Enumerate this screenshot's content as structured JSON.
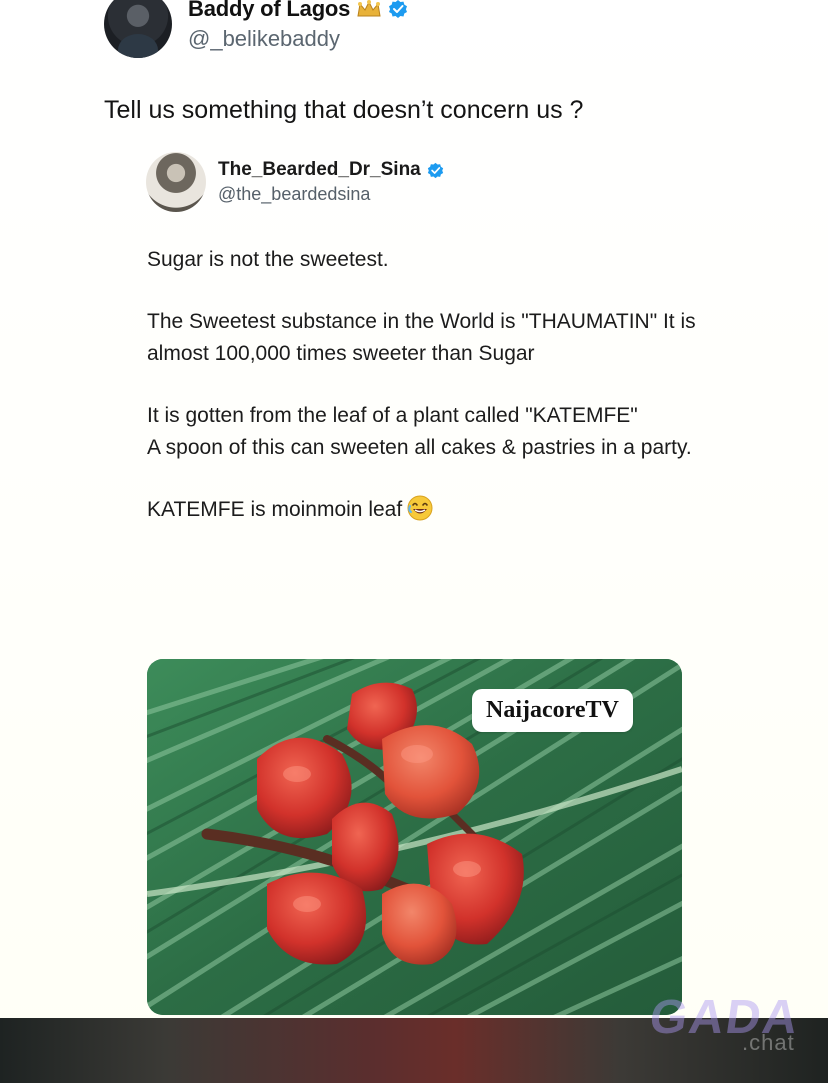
{
  "outer_tweet": {
    "name": "Baddy of Lagos",
    "handle": "@_belikebaddy",
    "text": "Tell us something that doesn’t concern us ?",
    "icons": [
      "crown-icon",
      "verified-icon"
    ]
  },
  "quoted_tweet": {
    "name": "The_Bearded_Dr_Sina",
    "handle": "@the_beardedsina",
    "paragraphs": [
      "Sugar is not the sweetest.",
      "The Sweetest substance in the World is \"THAUMATIN\" It is almost 100,000 times sweeter than Sugar",
      "It is gotten from the leaf of a plant called \"KATEMFE\"",
      "A spoon of this can sweeten all cakes & pastries in a party.",
      "KATEMFE is moinmoin leaf"
    ],
    "emoji": "laughing-emoji-icon"
  },
  "media": {
    "watermark": "NaijacoreTV"
  },
  "branding": {
    "mark": "GADA",
    "sub": ".chat"
  },
  "colors": {
    "verified": "#1d9bf0",
    "crown": "#e8b23a",
    "leaf": "#2f7a4a",
    "fruit": "#d8382f"
  }
}
